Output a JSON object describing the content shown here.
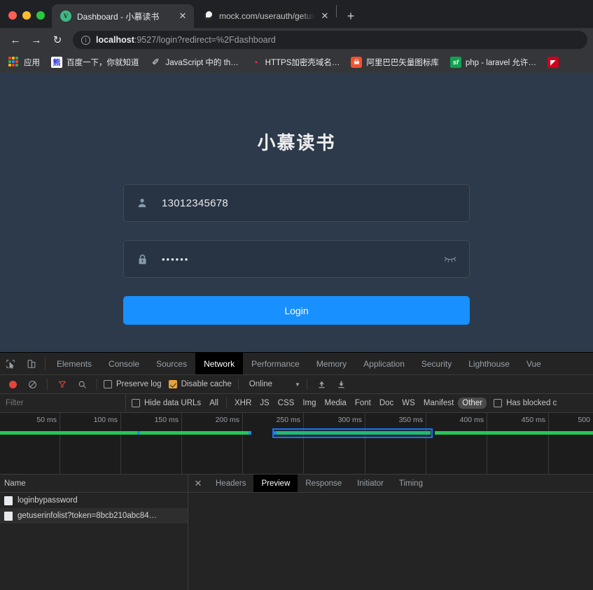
{
  "window": {
    "traffic_lights": [
      "close",
      "minimize",
      "maximize"
    ]
  },
  "tabs": [
    {
      "title": "Dashboard - 小慕读书",
      "favicon": "vue-icon",
      "active": true,
      "close_label": "✕"
    },
    {
      "title": "mock.com/userauth/getuserinf",
      "favicon": "globe-icon",
      "active": false,
      "close_label": "✕"
    }
  ],
  "newtab_label": "+",
  "toolbar": {
    "back_label": "←",
    "forward_label": "→",
    "reload_label": "↻",
    "info_label": "i",
    "url_host": "localhost",
    "url_rest": ":9527/login?redirect=%2Fdashboard"
  },
  "bookmarks": [
    {
      "label": "应用",
      "icon": "apps-grid-icon"
    },
    {
      "label": "百度一下，你就知道",
      "icon": "baidu-icon",
      "icon_text": "熊"
    },
    {
      "label": "JavaScript 中的 th…",
      "icon": "pen-icon",
      "icon_text": "✐"
    },
    {
      "label": "HTTPS加密壳域名…",
      "icon": "https-icon",
      "icon_text": "◔"
    },
    {
      "label": "阿里巴巴矢量图标库",
      "icon": "alibaba-icon",
      "icon_text": "☠"
    },
    {
      "label": "php - laravel 允许…",
      "icon": "sf-icon",
      "icon_text": "sf"
    },
    {
      "label": "",
      "icon": "clipped-bookmark-icon",
      "icon_text": "◤"
    }
  ],
  "login": {
    "title": "小慕读书",
    "username": {
      "value": "13012345678",
      "icon": "user-icon"
    },
    "password": {
      "value": "••••••",
      "icon": "lock-icon",
      "toggle_icon": "eye-closed-icon"
    },
    "submit_label": "Login",
    "accent_color": "#1890ff",
    "bg_color": "#2d3a4b"
  },
  "devtools": {
    "left_icons": [
      "inspect-element-icon",
      "device-toolbar-icon"
    ],
    "panels": [
      {
        "label": "Elements",
        "active": false
      },
      {
        "label": "Console",
        "active": false
      },
      {
        "label": "Sources",
        "active": false
      },
      {
        "label": "Network",
        "active": true
      },
      {
        "label": "Performance",
        "active": false
      },
      {
        "label": "Memory",
        "active": false
      },
      {
        "label": "Application",
        "active": false
      },
      {
        "label": "Security",
        "active": false
      },
      {
        "label": "Lighthouse",
        "active": false
      },
      {
        "label": "Vue",
        "active": false
      }
    ],
    "network_toolbar": {
      "record_icon": "record-button-icon",
      "clear_icon": "clear-icon",
      "filter_icon": "filter-funnel-icon",
      "search_icon": "search-icon",
      "preserve_log": {
        "label": "Preserve log",
        "checked": false
      },
      "disable_cache": {
        "label": "Disable cache",
        "checked": true
      },
      "throttle_value": "Online",
      "caret": "▼",
      "import_icon": "import-har-icon",
      "export_icon": "export-har-icon"
    },
    "filter_bar": {
      "filter_placeholder": "Filter",
      "filter_value": "",
      "hide_data_urls": {
        "label": "Hide data URLs",
        "checked": false
      },
      "types": [
        {
          "label": "All",
          "active": false
        },
        {
          "label": "XHR",
          "active": false
        },
        {
          "label": "JS",
          "active": false
        },
        {
          "label": "CSS",
          "active": false
        },
        {
          "label": "Img",
          "active": false
        },
        {
          "label": "Media",
          "active": false
        },
        {
          "label": "Font",
          "active": false
        },
        {
          "label": "Doc",
          "active": false
        },
        {
          "label": "WS",
          "active": false
        },
        {
          "label": "Manifest",
          "active": false
        },
        {
          "label": "Other",
          "active": true
        }
      ],
      "has_blocked": {
        "label": "Has blocked c",
        "checked": false
      }
    },
    "overview": {
      "ticks": [
        "50 ms",
        "100 ms",
        "150 ms",
        "200 ms",
        "250 ms",
        "300 ms",
        "350 ms",
        "400 ms",
        "450 ms",
        "500"
      ],
      "green_color": "#24c85a",
      "blue_color": "#1a8cff",
      "selection_color": "#1a73e8"
    },
    "requests": {
      "column_header": "Name",
      "rows": [
        {
          "name": "loginbypassword",
          "selected": false
        },
        {
          "name": "getuserinfolist?token=8bcb210abc84…",
          "selected": true
        }
      ]
    },
    "detail": {
      "close_label": "✕",
      "tabs": [
        {
          "label": "Headers",
          "active": false
        },
        {
          "label": "Preview",
          "active": true
        },
        {
          "label": "Response",
          "active": false
        },
        {
          "label": "Initiator",
          "active": false
        },
        {
          "label": "Timing",
          "active": false
        }
      ]
    }
  }
}
